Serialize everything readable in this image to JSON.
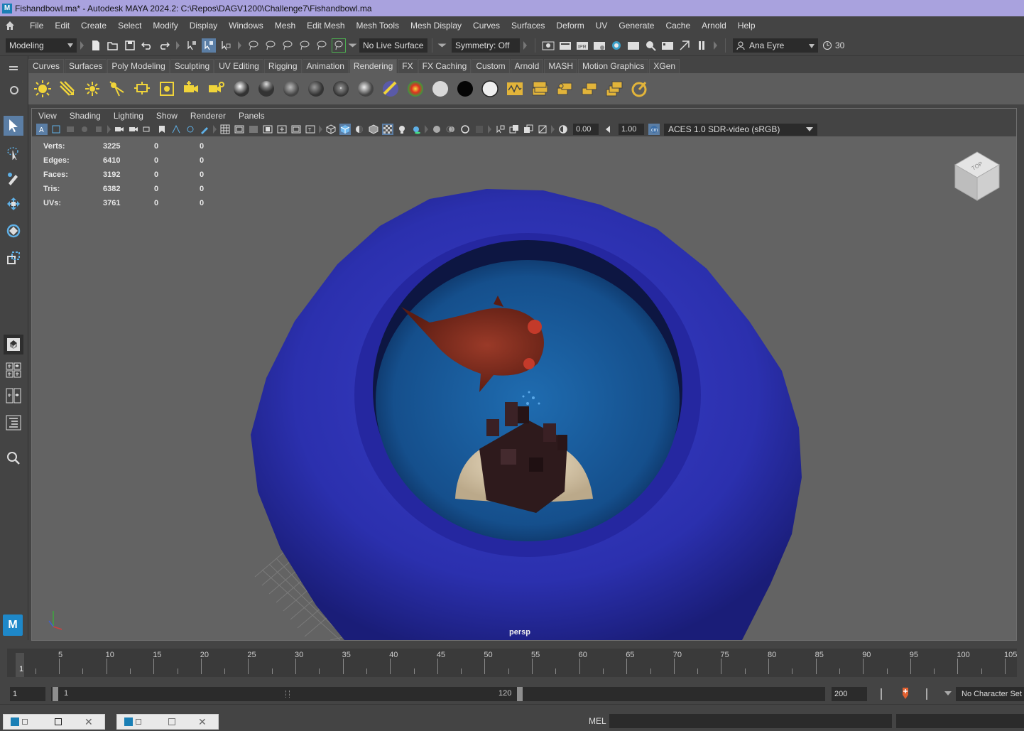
{
  "window": {
    "title": "Fishandbowl.ma* - Autodesk MAYA 2024.2: C:\\Repos\\DAGV1200\\Challenge7\\Fishandbowl.ma",
    "app_badge": "M"
  },
  "menu": [
    "File",
    "Edit",
    "Create",
    "Select",
    "Modify",
    "Display",
    "Windows",
    "Mesh",
    "Edit Mesh",
    "Mesh Tools",
    "Mesh Display",
    "Curves",
    "Surfaces",
    "Deform",
    "UV",
    "Generate",
    "Cache",
    "Arnold",
    "Help"
  ],
  "statusline": {
    "menuset": "Modeling",
    "live_surface": "No Live Surface",
    "symmetry": "Symmetry: Off",
    "user": "Ana Eyre",
    "notifications": "30"
  },
  "shelf": {
    "tabs": [
      "Curves",
      "Surfaces",
      "Poly Modeling",
      "Sculpting",
      "UV Editing",
      "Rigging",
      "Animation",
      "Rendering",
      "FX",
      "FX Caching",
      "Custom",
      "Arnold",
      "MASH",
      "Motion Graphics",
      "XGen"
    ],
    "active_tab": "Rendering"
  },
  "panel": {
    "menu": [
      "View",
      "Shading",
      "Lighting",
      "Show",
      "Renderer",
      "Panels"
    ],
    "exposure": "0.00",
    "gamma": "1.00",
    "color_space": "ACES 1.0 SDR-video (sRGB)",
    "camera": "persp",
    "viewcube_label": "TOP"
  },
  "hud": [
    {
      "label": "Verts:",
      "value": "3225",
      "a": "0",
      "b": "0"
    },
    {
      "label": "Edges:",
      "value": "6410",
      "a": "0",
      "b": "0"
    },
    {
      "label": "Faces:",
      "value": "3192",
      "a": "0",
      "b": "0"
    },
    {
      "label": "Tris:",
      "value": "6382",
      "a": "0",
      "b": "0"
    },
    {
      "label": "UVs:",
      "value": "3761",
      "a": "0",
      "b": "0"
    }
  ],
  "timeslider": {
    "ticks": [
      "5",
      "10",
      "15",
      "20",
      "25",
      "30",
      "35",
      "40",
      "45",
      "50",
      "55",
      "60",
      "65",
      "70",
      "75",
      "80",
      "85",
      "90",
      "95",
      "100",
      "105"
    ],
    "current_frame": "1"
  },
  "range": {
    "start": "1",
    "range_start": "1",
    "range_end": "120",
    "end": "200",
    "character_set": "No Character Set"
  },
  "commandline": {
    "mode": "MEL"
  },
  "colors": {
    "accent": "#5b7ea5",
    "title_bar": "#a9a2de",
    "bowl": "#2a2fb0",
    "water": "#1a5a9e",
    "fish": "#7a2a1e"
  }
}
